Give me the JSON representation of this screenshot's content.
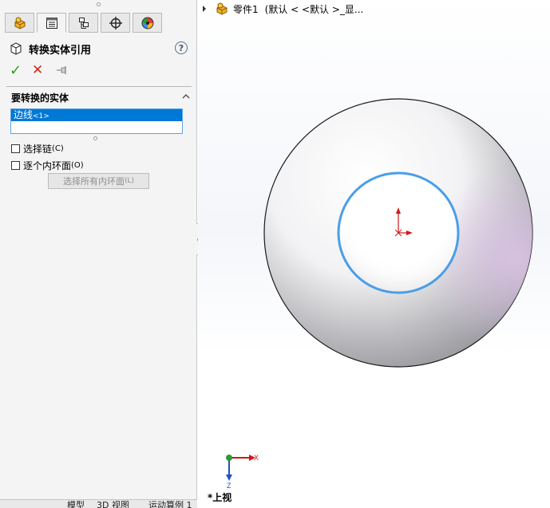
{
  "property_manager": {
    "tabs": [
      {
        "icon": "feature-manager-icon"
      },
      {
        "icon": "property-manager-icon"
      },
      {
        "icon": "configuration-manager-icon"
      },
      {
        "icon": "dimxpert-manager-icon"
      },
      {
        "icon": "display-manager-icon"
      }
    ],
    "title": "转换实体引用",
    "help": "?",
    "ok_icon": "checkmark-icon",
    "ok_label": "✓",
    "cancel_icon": "x-icon",
    "cancel_label": "✕",
    "pin_icon": "pushpin-icon",
    "group": {
      "title": "要转换的实体",
      "selections": [
        {
          "label": "边线",
          "suffix": "<1>"
        }
      ],
      "select_chain": {
        "label": "选择链",
        "accel": "(C)",
        "checked": false
      },
      "inner_loops": {
        "label": "逐个内环面",
        "accel": "(O)",
        "checked": false
      },
      "select_all_inner": {
        "label": "选择所有内环面",
        "accel": "(L)",
        "enabled": false
      }
    }
  },
  "bottom_tabs": [
    "模型",
    "3D 视图",
    "运动算例 1"
  ],
  "viewport": {
    "tree": {
      "part_name": "零件1",
      "config": "(默认 < <默认 >_显..."
    },
    "view_label": "*上视",
    "triad": {
      "x": "X",
      "z": "Z"
    },
    "colors": {
      "selected_edge": "#4a9ee8",
      "origin": "#d21818"
    }
  }
}
